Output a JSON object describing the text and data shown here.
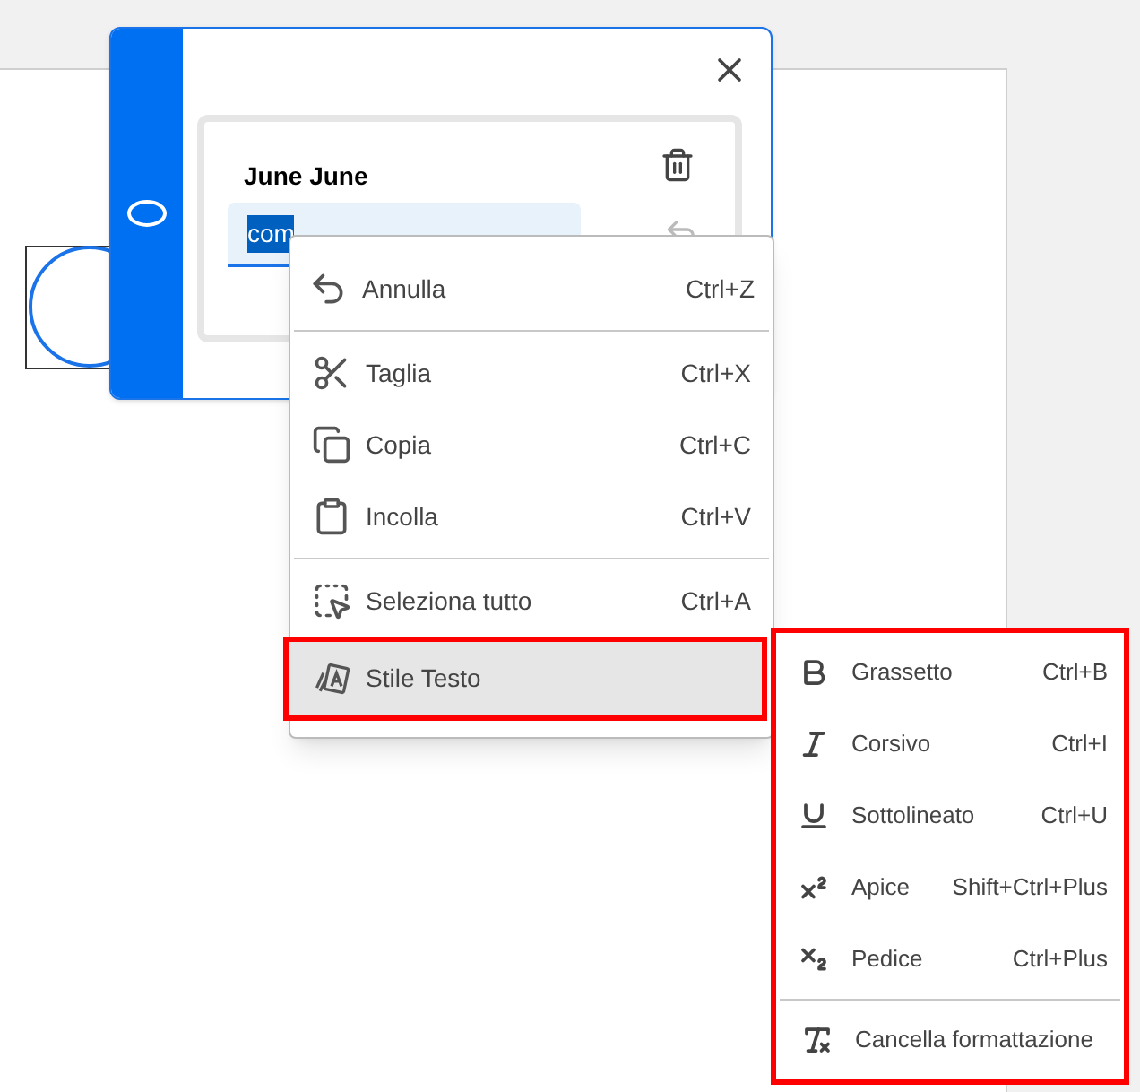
{
  "comment_panel": {
    "author": "June June",
    "comment_field": {
      "value": "com",
      "text_selected": true
    }
  },
  "context_menu": {
    "groups": [
      [
        {
          "label": "Annulla",
          "shortcut": "Ctrl+Z",
          "selected": false,
          "outlined": false
        }
      ],
      [
        {
          "label": "Taglia",
          "shortcut": "Ctrl+X",
          "selected": false,
          "outlined": false
        },
        {
          "label": "Copia",
          "shortcut": "Ctrl+C",
          "selected": false,
          "outlined": false
        },
        {
          "label": "Incolla",
          "shortcut": "Ctrl+V",
          "selected": false,
          "outlined": false
        }
      ],
      [
        {
          "label": "Seleziona tutto",
          "shortcut": "Ctrl+A",
          "selected": false,
          "outlined": false
        },
        {
          "label": "Stile Testo",
          "selected": true,
          "outlined": true
        }
      ]
    ]
  },
  "submenu": {
    "outlined": true,
    "groups": [
      [
        {
          "label": "Grassetto",
          "shortcut": "Ctrl+B"
        },
        {
          "label": "Corsivo",
          "shortcut": "Ctrl+I"
        },
        {
          "label": "Sottolineato",
          "shortcut": "Ctrl+U"
        },
        {
          "label": "Apice",
          "shortcut": "Shift+Ctrl+Plus"
        },
        {
          "label": "Pedice",
          "shortcut": "Ctrl+Plus"
        }
      ],
      [
        {
          "label": "Cancella formattazione"
        }
      ]
    ]
  }
}
